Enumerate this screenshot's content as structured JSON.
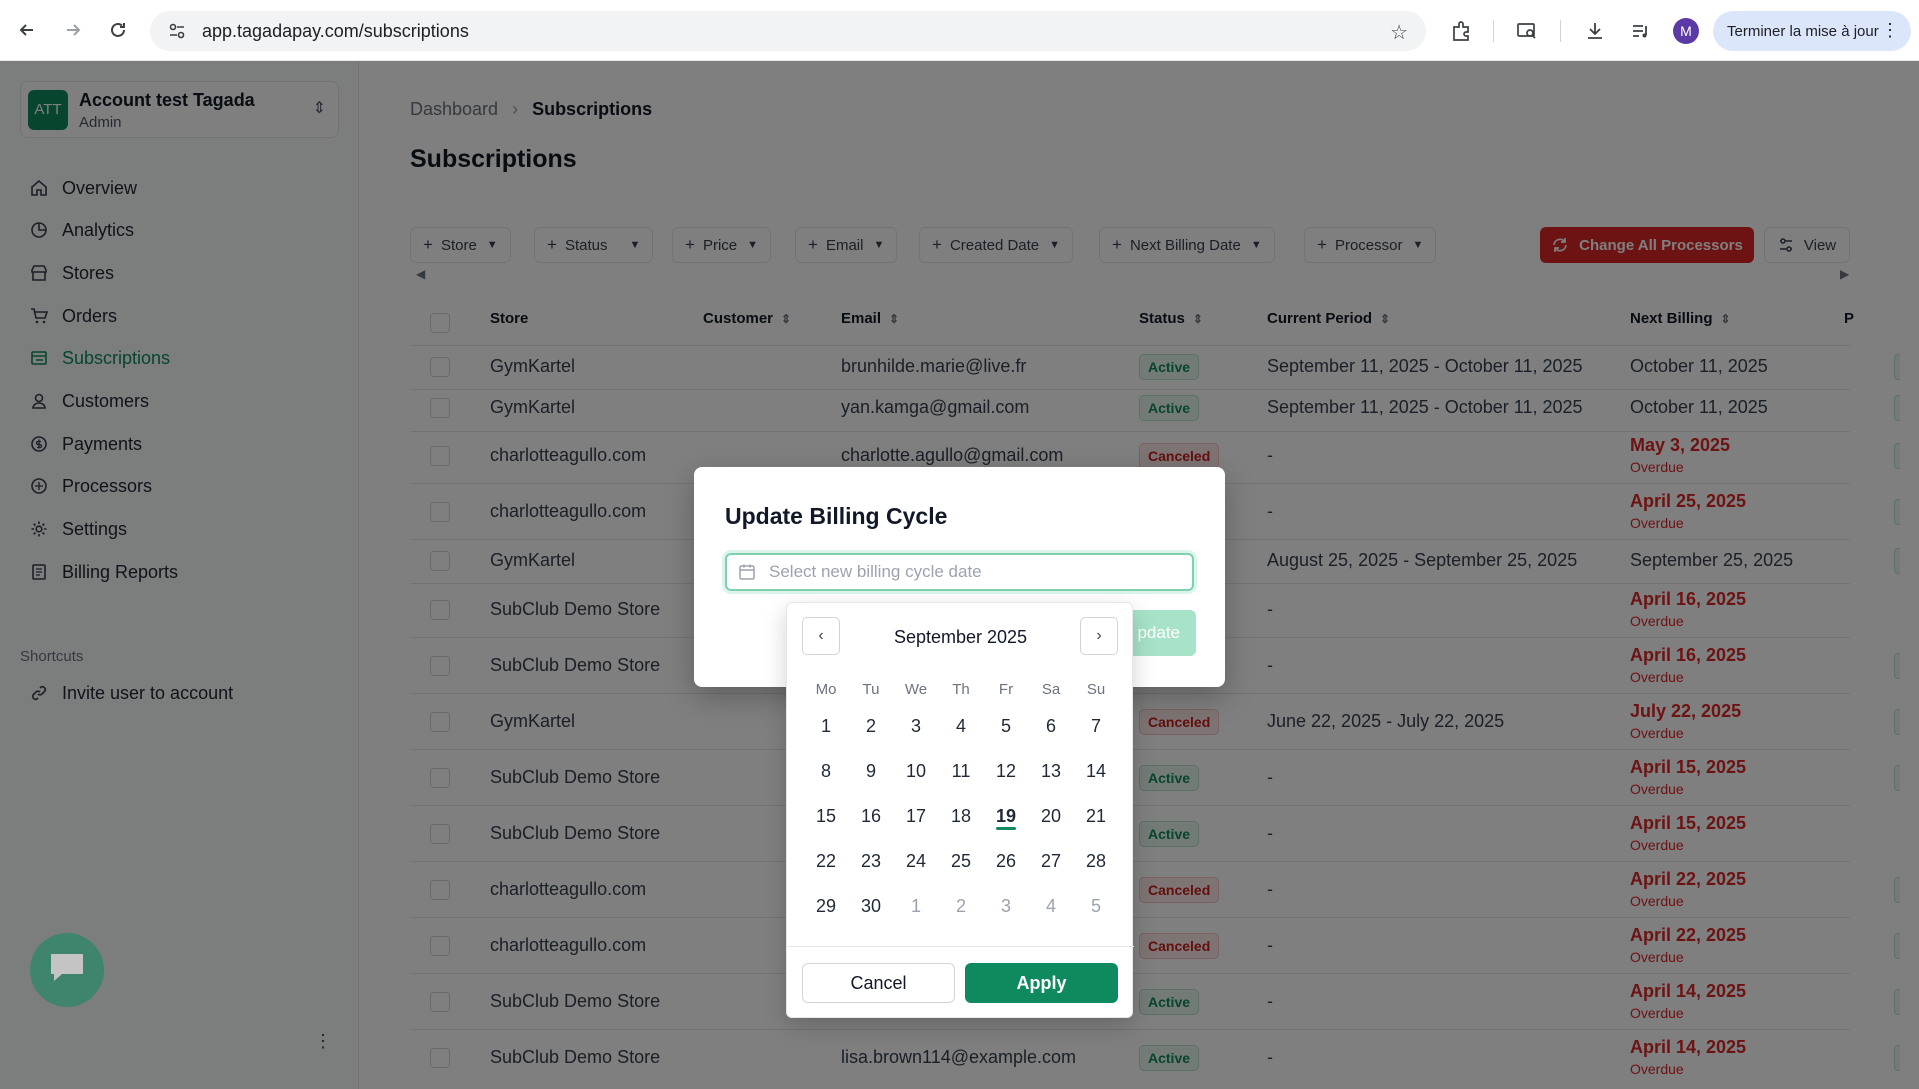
{
  "browser": {
    "url": "app.tagadapay.com/subscriptions",
    "profile_initial": "M",
    "update_label": "Terminer la mise à jour"
  },
  "sidebar": {
    "account_badge": "ATT",
    "account_name": "Account test Tagada",
    "account_role": "Admin",
    "items": [
      {
        "label": "Overview",
        "icon": "home-icon"
      },
      {
        "label": "Analytics",
        "icon": "pie-chart-icon"
      },
      {
        "label": "Stores",
        "icon": "store-icon"
      },
      {
        "label": "Orders",
        "icon": "cart-icon"
      },
      {
        "label": "Subscriptions",
        "icon": "list-icon",
        "active": true
      },
      {
        "label": "Customers",
        "icon": "user-icon"
      },
      {
        "label": "Payments",
        "icon": "dollar-icon"
      },
      {
        "label": "Processors",
        "icon": "processor-icon"
      },
      {
        "label": "Settings",
        "icon": "gear-icon"
      },
      {
        "label": "Billing Reports",
        "icon": "report-icon"
      }
    ],
    "shortcuts_label": "Shortcuts",
    "shortcut_items": [
      {
        "label": "Invite user to account",
        "icon": "link-icon"
      }
    ]
  },
  "main": {
    "breadcrumb": {
      "parent": "Dashboard",
      "current": "Subscriptions"
    },
    "title": "Subscriptions",
    "filters": [
      "Store",
      "Status",
      "Price",
      "Email",
      "Created Date",
      "Next Billing Date",
      "Processor"
    ],
    "change_all_label": "Change All Processors",
    "view_label": "View",
    "columns": [
      "Store",
      "Customer",
      "Email",
      "Status",
      "Current Period",
      "Next Billing",
      "P"
    ],
    "rows": [
      {
        "store": "GymKartel",
        "email": "brunhilde.marie@live.fr",
        "status": "Active",
        "period": "September 11, 2025 - October 11, 2025",
        "next": "October 11, 2025",
        "overdue": ""
      },
      {
        "store": "GymKartel",
        "email": "yan.kamga@gmail.com",
        "status": "Active",
        "period": "September 11, 2025 - October 11, 2025",
        "next": "October 11, 2025",
        "overdue": ""
      },
      {
        "store": "charlotteagullo.com",
        "email": "charlotte.agullo@gmail.com",
        "status": "Canceled",
        "period": "-",
        "next": "May 3, 2025",
        "overdue": "Overdue"
      },
      {
        "store": "charlotteagullo.com",
        "email": "",
        "status": "",
        "period": "-",
        "next": "April 25, 2025",
        "overdue": "Overdue"
      },
      {
        "store": "GymKartel",
        "email": "",
        "status": "",
        "period": "August 25, 2025 - September 25, 2025",
        "next": "September 25, 2025",
        "overdue": ""
      },
      {
        "store": "SubClub Demo Store",
        "email": "",
        "status": "",
        "period": "-",
        "next": "April 16, 2025",
        "overdue": "Overdue"
      },
      {
        "store": "SubClub Demo Store",
        "email": "",
        "status": "",
        "period": "-",
        "next": "April 16, 2025",
        "overdue": "Overdue"
      },
      {
        "store": "GymKartel",
        "email": "",
        "status": "Canceled",
        "period": "June 22, 2025 - July 22, 2025",
        "next": "July 22, 2025",
        "overdue": "Overdue"
      },
      {
        "store": "SubClub Demo Store",
        "email": "",
        "status": "Active",
        "period": "-",
        "next": "April 15, 2025",
        "overdue": "Overdue"
      },
      {
        "store": "SubClub Demo Store",
        "email": "",
        "status": "Active",
        "period": "-",
        "next": "April 15, 2025",
        "overdue": "Overdue"
      },
      {
        "store": "charlotteagullo.com",
        "email": "",
        "status": "Canceled",
        "period": "-",
        "next": "April 22, 2025",
        "overdue": "Overdue"
      },
      {
        "store": "charlotteagullo.com",
        "email": "",
        "status": "Canceled",
        "period": "-",
        "next": "April 22, 2025",
        "overdue": "Overdue"
      },
      {
        "store": "SubClub Demo Store",
        "email": "",
        "status": "Active",
        "period": "-",
        "next": "April 14, 2025",
        "overdue": "Overdue"
      },
      {
        "store": "SubClub Demo Store",
        "email": "lisa.brown114@example.com",
        "status": "Active",
        "period": "-",
        "next": "April 14, 2025",
        "overdue": "Overdue"
      }
    ]
  },
  "modal": {
    "title": "Update Billing Cycle",
    "placeholder": "Select new billing cycle date",
    "update_label": "pdate"
  },
  "datepicker": {
    "month_label": "September 2025",
    "weekdays": [
      "Mo",
      "Tu",
      "We",
      "Th",
      "Fr",
      "Sa",
      "Su"
    ],
    "weeks": [
      [
        "1",
        "2",
        "3",
        "4",
        "5",
        "6",
        "7"
      ],
      [
        "8",
        "9",
        "10",
        "11",
        "12",
        "13",
        "14"
      ],
      [
        "15",
        "16",
        "17",
        "18",
        "19",
        "20",
        "21"
      ],
      [
        "22",
        "23",
        "24",
        "25",
        "26",
        "27",
        "28"
      ],
      [
        "29",
        "30",
        "1",
        "2",
        "3",
        "4",
        "5"
      ]
    ],
    "today": "19",
    "cancel_label": "Cancel",
    "apply_label": "Apply"
  },
  "colors": {
    "brand": "#0f8a5f",
    "danger": "#dc2626"
  }
}
